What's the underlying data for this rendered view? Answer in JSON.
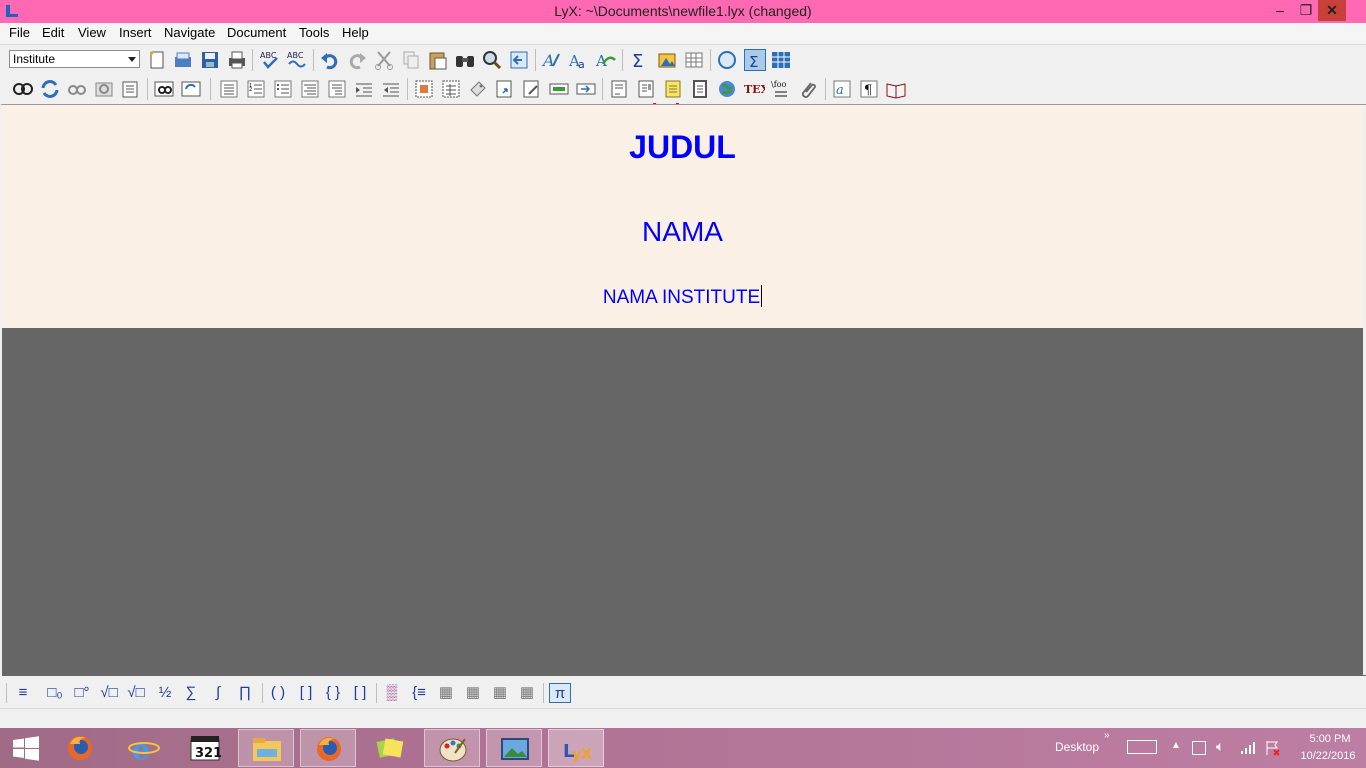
{
  "window": {
    "title": "LyX: ~\\Documents\\newfile1.lyx (changed)",
    "controls": {
      "minimize": "–",
      "maximize": "❐",
      "close": "✕"
    }
  },
  "menu": {
    "items": [
      "File",
      "Edit",
      "View",
      "Insert",
      "Navigate",
      "Document",
      "Tools",
      "Help"
    ]
  },
  "toolbar": {
    "layout_select_value": "Institute"
  },
  "document": {
    "title": "JUDUL",
    "author": "NAMA",
    "institute": "NAMA INSTITUTE"
  },
  "mathbar": {
    "glyphs": [
      "≡",
      "□₀",
      "□°",
      "√□",
      "√□",
      "½",
      "∑",
      "∫",
      "∏",
      "( )",
      "[ ]",
      "{ }",
      "[ ]",
      "▒",
      "{≡",
      "▦",
      "▦",
      "▦",
      "▦",
      "π"
    ]
  },
  "taskbar": {
    "apps": [
      "firefox",
      "internet-explorer",
      "calendar",
      "file-explorer",
      "firefox",
      "sticky-notes",
      "paint",
      "photos",
      "lyx"
    ],
    "desktop_label": "Desktop",
    "time": "5:00 PM",
    "date": "10/22/2016"
  },
  "colors": {
    "titlebar": "#ff69b4",
    "document_background": "#faf0e6",
    "document_text": "#0000ff",
    "workarea": "#666666",
    "taskbar": "#b07394"
  }
}
